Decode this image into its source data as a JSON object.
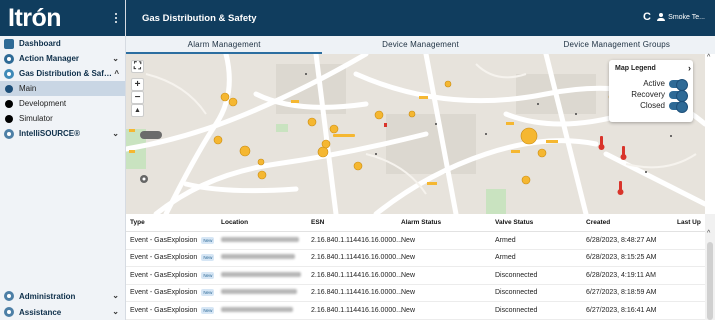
{
  "brand": {
    "logo_text": "Itrón"
  },
  "sidebar": {
    "items": [
      {
        "label": "Dashboard",
        "icon": "dashboard-icon",
        "bold": true,
        "chevron": ""
      },
      {
        "label": "Action Manager",
        "icon": "action-manager-icon",
        "bold": true,
        "chevron": "⌄"
      },
      {
        "label": "Gas Distribution & Saf…",
        "icon": "gas-distribution-icon",
        "bold": true,
        "chevron": "^"
      },
      {
        "label": "Main",
        "icon": "main-dot-icon",
        "bold": false,
        "chevron": ""
      },
      {
        "label": "Development",
        "icon": "development-dot-icon",
        "bold": false,
        "chevron": ""
      },
      {
        "label": "Simulator",
        "icon": "simulator-dot-icon",
        "bold": false,
        "chevron": ""
      },
      {
        "label": "IntelliSOURCE®",
        "icon": "intellisource-icon",
        "bold": true,
        "chevron": "⌄"
      }
    ],
    "bottom_items": [
      {
        "label": "Administration",
        "icon": "administration-icon",
        "chevron": "⌄"
      },
      {
        "label": "Assistance",
        "icon": "assistance-icon",
        "chevron": "⌄"
      }
    ]
  },
  "header": {
    "title": "Gas Distribution & Safety",
    "refresh_glyph": "C",
    "user_name": "Smoke Te..."
  },
  "tabs": [
    {
      "label": "Alarm Management",
      "active": true
    },
    {
      "label": "Device Management",
      "active": false
    },
    {
      "label": "Device Management Groups",
      "active": false
    }
  ],
  "map": {
    "legend": {
      "title": "Map Legend",
      "expand_glyph": "›",
      "items": [
        {
          "label": "Active",
          "on": true
        },
        {
          "label": "Recovery",
          "on": true
        },
        {
          "label": "Closed",
          "on": true
        }
      ]
    },
    "controls": {
      "fullscreen": "⛶",
      "zoom_in": "+",
      "zoom_out": "−",
      "compass": "▲"
    },
    "colors": {
      "alarm_marker": "#f5b731",
      "danger_marker": "#d9342b",
      "road": "#ffffff",
      "block": "#d9d5ce"
    }
  },
  "table": {
    "columns": [
      "Type",
      "Location",
      "ESN",
      "Alarm Status",
      "Valve Status",
      "Created",
      "Last Up"
    ],
    "badge": "New",
    "rows": [
      {
        "type": "Event - GasExplosion",
        "esn": "2.16.840.1.114416.16.0000...",
        "alarm": "New",
        "valve": "Armed",
        "created": "6/28/2023, 8:48:27 AM"
      },
      {
        "type": "Event - GasExplosion",
        "esn": "2.16.840.1.114416.16.0000...",
        "alarm": "New",
        "valve": "Armed",
        "created": "6/28/2023, 8:15:25 AM"
      },
      {
        "type": "Event - GasExplosion",
        "esn": "2.16.840.1.114416.16.0000...",
        "alarm": "New",
        "valve": "Disconnected",
        "created": "6/28/2023, 4:19:11 AM"
      },
      {
        "type": "Event - GasExplosion",
        "esn": "2.16.840.1.114416.16.0000...",
        "alarm": "New",
        "valve": "Disconnected",
        "created": "6/27/2023, 8:18:59 AM"
      },
      {
        "type": "Event - GasExplosion",
        "esn": "2.16.840.1.114416.16.0000...",
        "alarm": "New",
        "valve": "Disconnected",
        "created": "6/27/2023, 8:16:41 AM"
      }
    ]
  }
}
